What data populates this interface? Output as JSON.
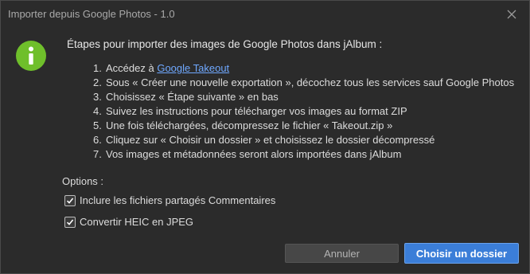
{
  "window": {
    "title": "Importer depuis Google Photos - 1.0"
  },
  "content": {
    "heading": "Étapes pour importer des images de Google Photos dans jAlbum :",
    "steps": [
      {
        "num": "1.",
        "text": "Accédez à ",
        "link": "Google Takeout"
      },
      {
        "num": "2.",
        "text": "Sous « Créer une nouvelle exportation », décochez tous les services sauf Google Photos"
      },
      {
        "num": "3.",
        "text": "Choisissez « Étape suivante » en bas"
      },
      {
        "num": "4.",
        "text": "Suivez les instructions pour télécharger vos images au format ZIP"
      },
      {
        "num": "5.",
        "text": "Une fois téléchargées, décompressez le fichier « Takeout.zip »"
      },
      {
        "num": "6.",
        "text": "Cliquez sur « Choisir un dossier » et choisissez le dossier décompressé"
      },
      {
        "num": "7.",
        "text": "Vos images et métadonnées seront alors importées dans jAlbum"
      }
    ]
  },
  "options": {
    "label": "Options :",
    "include_shared": {
      "label": "Inclure les fichiers partagés Commentaires",
      "checked": true
    },
    "convert_heic": {
      "label": "Convertir HEIC en JPEG",
      "checked": true
    }
  },
  "buttons": {
    "cancel": "Annuler",
    "choose_folder": "Choisir un dossier"
  },
  "icons": {
    "info": "info-icon",
    "close": "close-icon",
    "check": "checkmark-icon"
  },
  "colors": {
    "info_icon": "#6fbf2b",
    "link": "#6fa8ff",
    "primary_button": "#3b7ed8"
  }
}
